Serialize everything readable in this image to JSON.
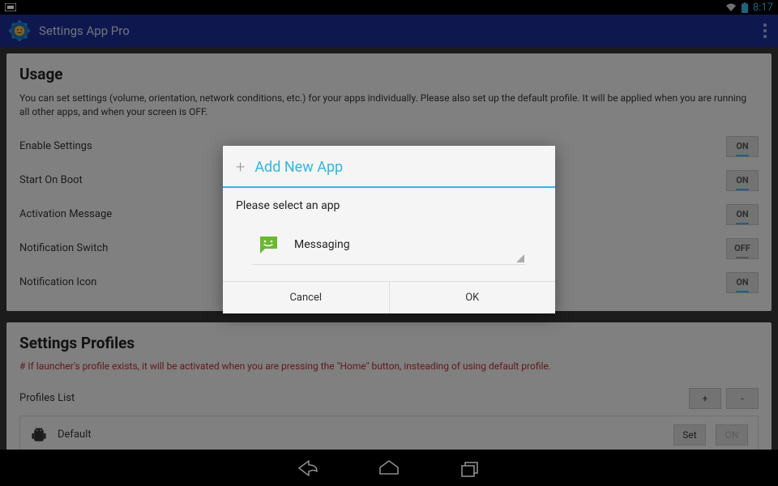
{
  "status": {
    "time": "8:17"
  },
  "actionbar": {
    "title": "Settings App Pro"
  },
  "usage": {
    "heading": "Usage",
    "description": "You can set settings (volume, orientation, network conditions, etc.) for your apps individually. Please also set up the default profile. It will be applied when you are running all other apps, and when your screen is OFF.",
    "rows": {
      "enable": {
        "label": "Enable Settings",
        "value": "ON"
      },
      "boot": {
        "label": "Start On Boot",
        "value": "ON"
      },
      "activation": {
        "label": "Activation Message",
        "value": "ON"
      },
      "notifswitch": {
        "label": "Notification Switch",
        "value": "OFF"
      },
      "notificon": {
        "label": "Notification Icon",
        "value": "ON"
      }
    }
  },
  "profiles": {
    "heading": "Settings Profiles",
    "note": "# If launcher's profile exists, it will be activated when you are pressing the \"Home\" button, insteading of using default profile.",
    "listLabel": "Profiles List",
    "add": "+",
    "remove": "-",
    "defaultRow": {
      "name": "Default",
      "set": "Set",
      "state": "ON"
    }
  },
  "dialog": {
    "title": "Add New App",
    "prompt": "Please select an app",
    "selected": "Messaging",
    "cancel": "Cancel",
    "ok": "OK"
  }
}
